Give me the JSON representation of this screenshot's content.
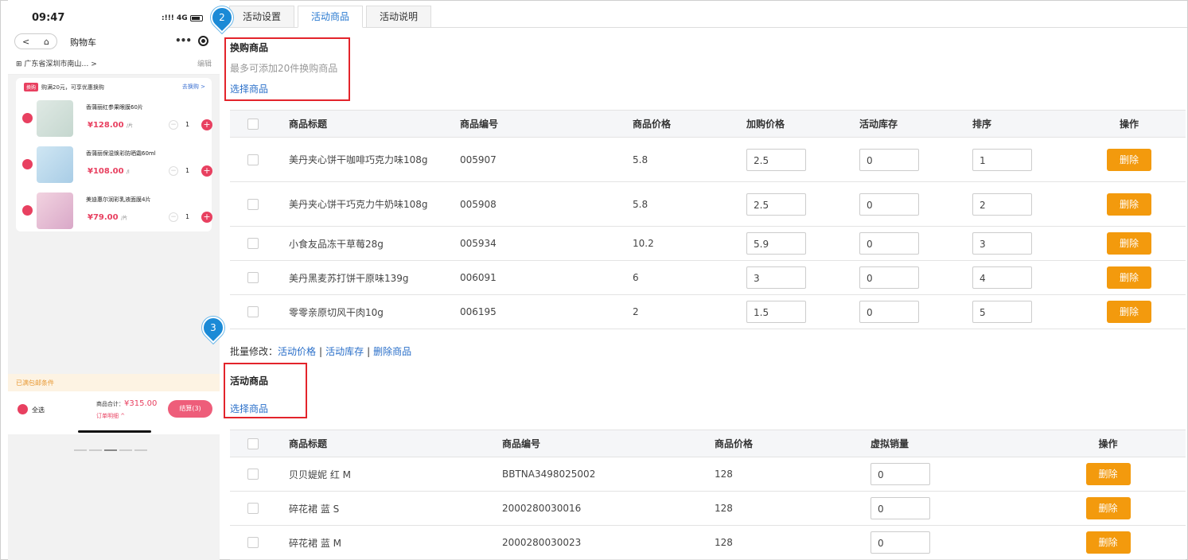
{
  "phone": {
    "time": "09:47",
    "signal": "4G",
    "nav_back": "<",
    "nav_home": "⌂",
    "nav_title": "购物车",
    "address": "⊞ 广东省深圳市南山… >",
    "address_edit": "编辑",
    "promo_tag": "换购",
    "promo_text": "购满20元，可享优惠换购",
    "promo_link": "去换购 >",
    "items": [
      {
        "name": "香蒲丽红参果眼膜60片",
        "price": "¥128.00",
        "unit": "/片",
        "qty": "1"
      },
      {
        "name": "香蒲丽保湿焕彩防晒霜60ml",
        "price": "¥108.00",
        "unit": "/l",
        "qty": "1"
      },
      {
        "name": "美迪惠尔润彩乳液面膜4片",
        "price": "¥79.00",
        "unit": "/片",
        "qty": "1"
      }
    ],
    "free_shipping": "已满包邮条件",
    "select_all": "全选",
    "total_label": "商品合计：",
    "total_value": "¥315.00",
    "order_detail": "订单明细 ^",
    "checkout": "结算(3)"
  },
  "tabs": [
    {
      "label": "活动设置",
      "active": false
    },
    {
      "label": "活动商品",
      "active": true
    },
    {
      "label": "活动说明",
      "active": false
    }
  ],
  "markers": {
    "m2": "2",
    "m3": "3"
  },
  "exchange_section": {
    "title": "换购商品",
    "hint": "最多可添加20件换购商品",
    "select_link": "选择商品"
  },
  "exchange_table": {
    "headers": [
      "商品标题",
      "商品编号",
      "商品价格",
      "加购价格",
      "活动库存",
      "排序",
      "操作"
    ],
    "rows": [
      {
        "title": "美丹夹心饼干咖啡巧克力味108g",
        "code": "005907",
        "price": "5.8",
        "add_price": "2.5",
        "stock": "0",
        "sort": "1"
      },
      {
        "title": "美丹夹心饼干巧克力牛奶味108g",
        "code": "005908",
        "price": "5.8",
        "add_price": "2.5",
        "stock": "0",
        "sort": "2"
      },
      {
        "title": "小食友品冻干草莓28g",
        "code": "005934",
        "price": "10.2",
        "add_price": "5.9",
        "stock": "0",
        "sort": "3"
      },
      {
        "title": "美丹黑麦苏打饼干原味139g",
        "code": "006091",
        "price": "6",
        "add_price": "3",
        "stock": "0",
        "sort": "4"
      },
      {
        "title": "零零亲原切风干肉10g",
        "code": "006195",
        "price": "2",
        "add_price": "1.5",
        "stock": "0",
        "sort": "5"
      }
    ],
    "delete_label": "删除"
  },
  "batch": {
    "label": "批量修改：",
    "links": [
      "活动价格",
      "活动库存",
      "删除商品"
    ],
    "separator": "|"
  },
  "activity_section": {
    "title": "活动商品",
    "select_link": "选择商品"
  },
  "activity_table": {
    "headers": [
      "商品标题",
      "商品编号",
      "商品价格",
      "虚拟销量",
      "操作"
    ],
    "rows": [
      {
        "title": "贝贝媞妮 红 M",
        "code": "BBTNA3498025002",
        "price": "128",
        "virtual_sales": "0"
      },
      {
        "title": "碎花裙 蓝 S",
        "code": "2000280030016",
        "price": "128",
        "virtual_sales": "0"
      },
      {
        "title": "碎花裙 蓝 M",
        "code": "2000280030023",
        "price": "128",
        "virtual_sales": "0"
      }
    ],
    "delete_label": "删除"
  }
}
